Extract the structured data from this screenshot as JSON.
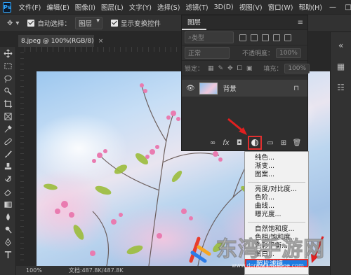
{
  "app": {
    "logo": "Ps"
  },
  "menubar": [
    "文件(F)",
    "编辑(E)",
    "图像(I)",
    "图层(L)",
    "文字(Y)",
    "选择(S)",
    "滤镜(T)",
    "3D(D)",
    "视图(V)",
    "窗口(W)",
    "帮助(H)"
  ],
  "window_controls": {
    "minimize": "—",
    "maximize": "□",
    "close": "✕"
  },
  "options": {
    "auto_select_label": "自动选择：",
    "auto_select_value": "图层",
    "show_transform_label": "显示变换控件"
  },
  "document": {
    "tab_title": "8.jpeg @ 100%(RGB/8)",
    "close": "×"
  },
  "status": {
    "zoom": "100%",
    "doc_info": "文档:487.8K/487.8K"
  },
  "layers_panel": {
    "title": "图层",
    "menu_icon": "≡",
    "filter_kind": "类型",
    "blend_mode": "正常",
    "opacity_label": "不透明度：",
    "opacity_value": "100%",
    "lock_label": "锁定：",
    "fill_label": "填充：",
    "fill_value": "100%",
    "layer_name": "背景",
    "lock_icon": "🔒",
    "footer_icons": [
      "link-icon",
      "fx-icon",
      "mask-icon",
      "adjustment-icon",
      "folder-icon",
      "new-layer-icon",
      "trash-icon"
    ],
    "fx_label": "fx"
  },
  "adjustment_menu": {
    "group1": [
      "纯色...",
      "渐变...",
      "图案..."
    ],
    "group2": [
      "亮度/对比度...",
      "色阶...",
      "曲线...",
      "曝光度..."
    ],
    "group3": [
      "自然饱和度...",
      "色相/饱和度...",
      "色彩平衡...",
      "黑白..."
    ],
    "highlighted": "照片滤镜..."
  },
  "watermark": {
    "text": "东湾手游网",
    "url": "www.dongwanhuoge.com"
  },
  "colors": {
    "accent_blue": "#1e7be0",
    "highlight_red": "#e03030",
    "ps_blue": "#31a8ff"
  }
}
